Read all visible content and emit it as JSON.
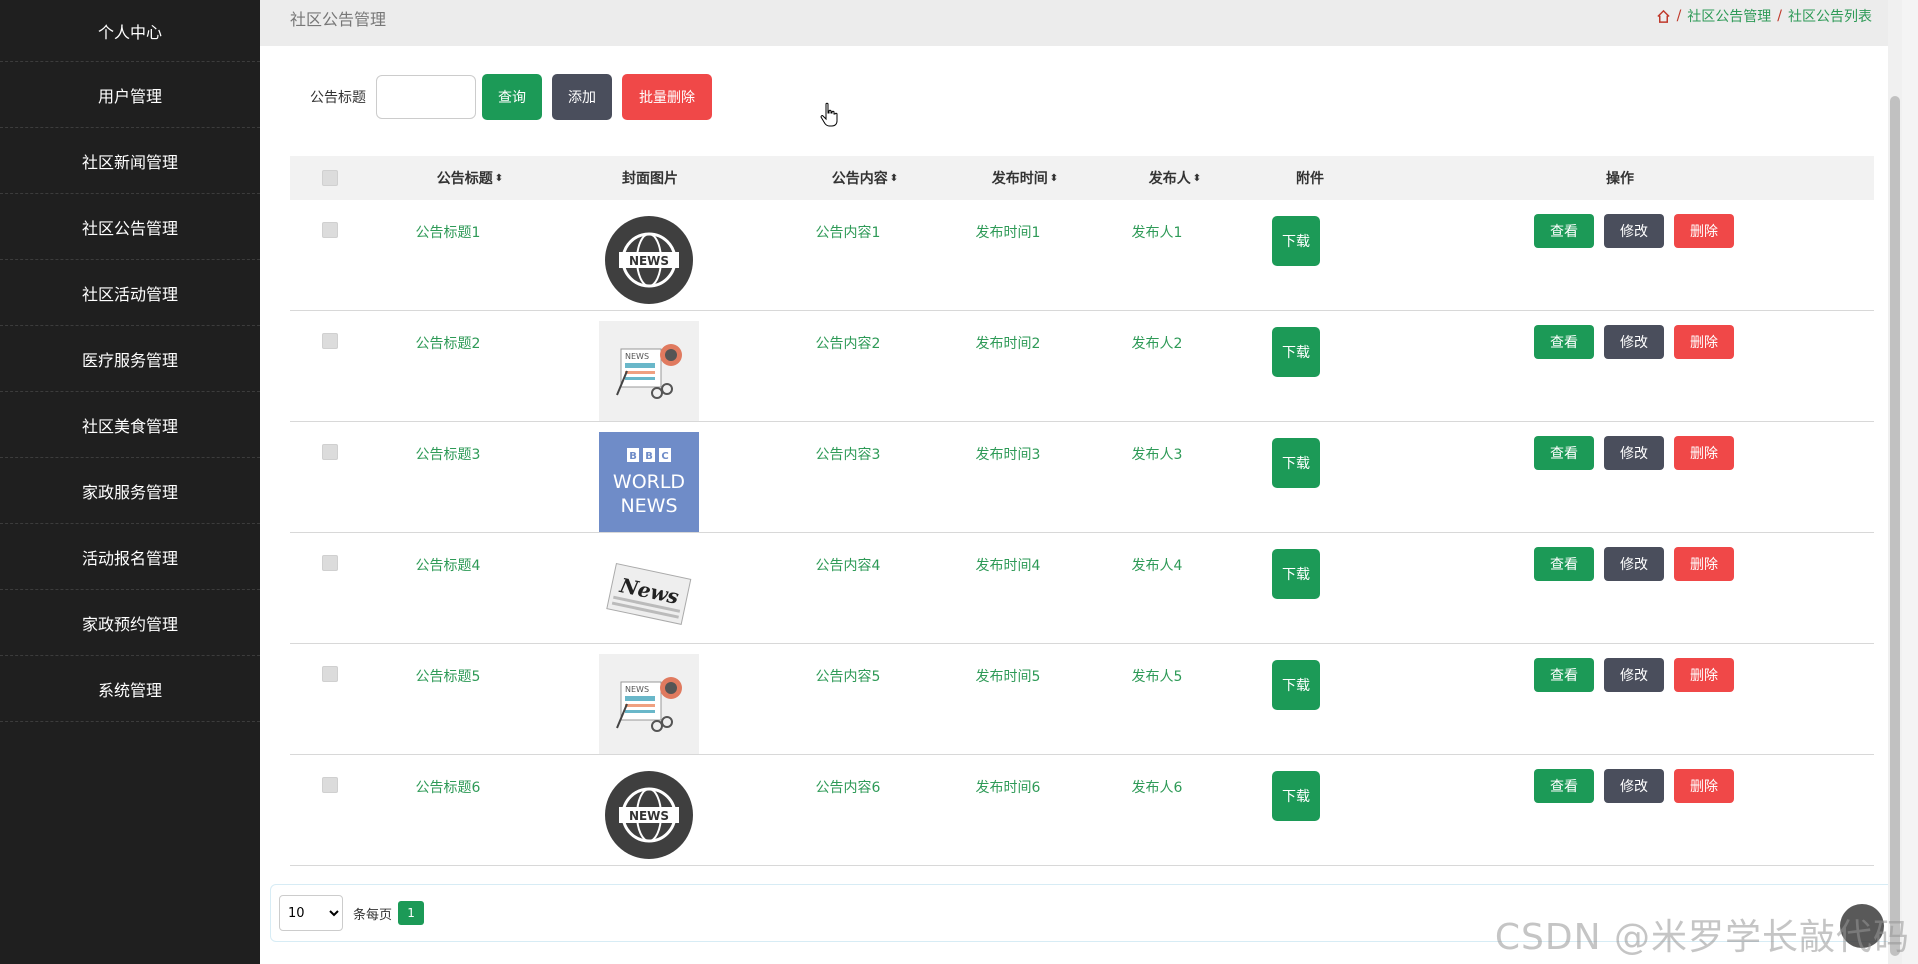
{
  "sidebar": {
    "items": [
      {
        "label": "个人中心"
      },
      {
        "label": "用户管理"
      },
      {
        "label": "社区新闻管理"
      },
      {
        "label": "社区公告管理"
      },
      {
        "label": "社区活动管理"
      },
      {
        "label": "医疗服务管理"
      },
      {
        "label": "社区美食管理"
      },
      {
        "label": "家政服务管理"
      },
      {
        "label": "活动报名管理"
      },
      {
        "label": "家政预约管理"
      },
      {
        "label": "系统管理"
      }
    ]
  },
  "header": {
    "title": "社区公告管理",
    "breadcrumb": [
      "社区公告管理",
      "社区公告列表"
    ],
    "separator": "/"
  },
  "search": {
    "label": "公告标题",
    "value": "",
    "query_label": "查询",
    "add_label": "添加",
    "batch_delete_label": "批量删除"
  },
  "table": {
    "columns": {
      "title": "公告标题",
      "cover": "封面图片",
      "content": "公告内容",
      "time": "发布时间",
      "publisher": "发布人",
      "attachment": "附件",
      "actions": "操作"
    },
    "sort_glyph": "⬍",
    "rows": [
      {
        "title": "公告标题1",
        "content": "公告内容1",
        "time": "发布时间1",
        "publisher": "发布人1",
        "cover": "news-globe-icon"
      },
      {
        "title": "公告标题2",
        "content": "公告内容2",
        "time": "发布时间2",
        "publisher": "发布人2",
        "cover": "newspaper-magnifier-icon"
      },
      {
        "title": "公告标题3",
        "content": "公告内容3",
        "time": "发布时间3",
        "publisher": "发布人3",
        "cover": "bbc-world-news-logo"
      },
      {
        "title": "公告标题4",
        "content": "公告内容4",
        "time": "发布时间4",
        "publisher": "发布人4",
        "cover": "news-paper-icon"
      },
      {
        "title": "公告标题5",
        "content": "公告内容5",
        "time": "发布时间5",
        "publisher": "发布人5",
        "cover": "newspaper-magnifier-icon"
      },
      {
        "title": "公告标题6",
        "content": "公告内容6",
        "time": "发布时间6",
        "publisher": "发布人6",
        "cover": "news-globe-icon"
      }
    ],
    "download_label": "下载",
    "view_label": "查看",
    "edit_label": "修改",
    "delete_label": "删除"
  },
  "pager": {
    "page_size": "10",
    "per_page_label": "条每页",
    "current_page": "1"
  },
  "watermark": "CSDN @米罗学长敲代码",
  "colors": {
    "accent": "#1c9a57",
    "dark": "#4a4e5c",
    "danger": "#f04848",
    "sidebar": "#1f1f1f"
  }
}
